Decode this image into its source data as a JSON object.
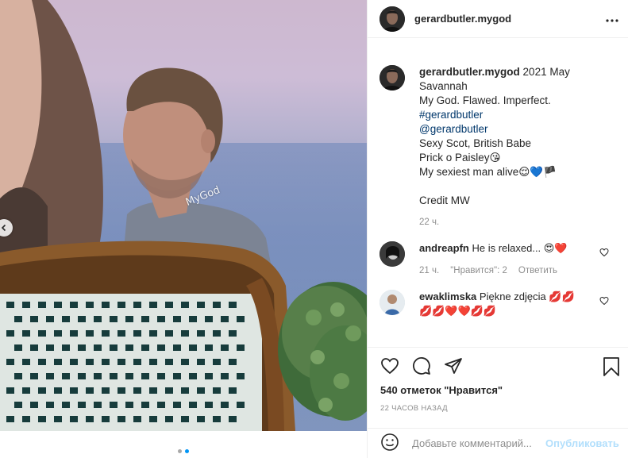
{
  "media": {
    "watermark": "MyGod"
  },
  "header": {
    "username": "gerardbutler.mygod"
  },
  "caption": {
    "username": "gerardbutler.mygod",
    "first_line": "2021 May",
    "lines": [
      "Savannah",
      "My God. Flawed. Imperfect."
    ],
    "hashtag": "#gerardbutler",
    "mention": "@gerardbutler",
    "line_scot": "Sexy Scot, British Babe",
    "line_prick": "Prick o Paisley",
    "line_prick_emoji": "😘",
    "line_sexiest": "My sexiest man alive",
    "line_sexiest_emoji": "😌💙🏴",
    "credit": "Credit MW",
    "time": "22 ч."
  },
  "comments": [
    {
      "username": "andreapfn",
      "text": "He is relaxed...",
      "emoji": "😍❤️",
      "time": "21 ч.",
      "likes": "\"Нравится\": 2",
      "reply": "Ответить"
    },
    {
      "username": "ewaklimska",
      "text": "Piękne zdjęcia",
      "emoji": "💋💋",
      "emoji_line2": "💋💋❤️❤️💋💋"
    }
  ],
  "likes_text": "540 отметок \"Нравится\"",
  "timestamp": "22 ЧАСОВ НАЗАД",
  "add_comment": {
    "placeholder": "Добавьте комментарий...",
    "post_label": "Опубликовать"
  },
  "colors": {
    "accent": "#0095f6",
    "link": "#00376b",
    "muted": "#8e8e8e"
  },
  "icons": [
    "more-icon",
    "heart-icon",
    "comment-icon",
    "share-icon",
    "bookmark-icon",
    "emoji-icon",
    "chevron-left-icon"
  ]
}
